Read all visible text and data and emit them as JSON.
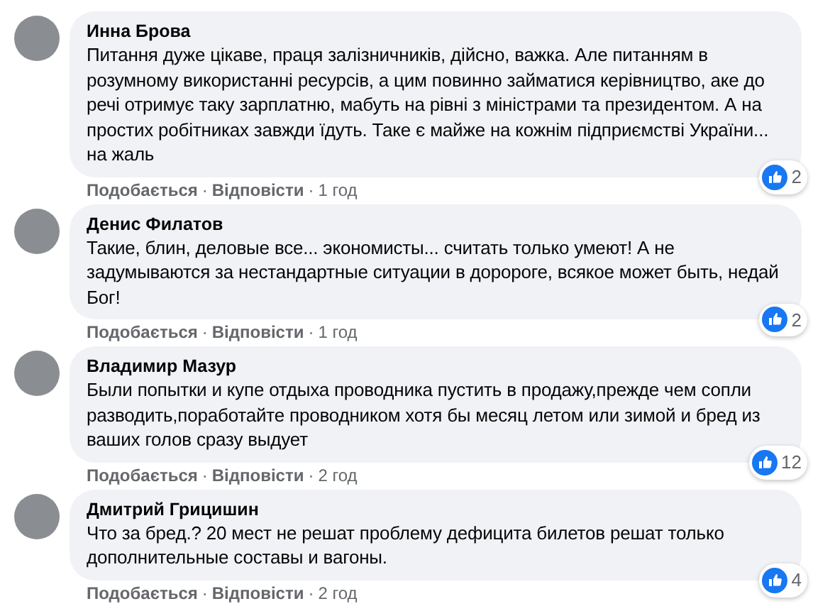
{
  "comments": [
    {
      "author": "Инна Брова",
      "text": "Питання дуже цікаве, праця залізничників, дійсно, важка. Але питанням в розумному використанні ресурсів, а цим повинно займатися керівництво, аке до речі отримує таку зарплатню, мабуть на рівні з міністрами та президентом. А на простих робітниках завжди їдуть. Таке є майже на кожнім підприємстві України... на жаль",
      "reactions": "2",
      "like": "Подобається",
      "separator_1": "·",
      "reply": "Відповісти",
      "separator_2": "·",
      "time": "1 год"
    },
    {
      "author": "Денис Филатов",
      "text": "Такие, блин, деловые все... экономисты... считать только умеют! А не задумываются за нестандартные ситуации в доророге, всякое может быть, недай Бог!",
      "reactions": "2",
      "like": "Подобається",
      "separator_1": "·",
      "reply": "Відповісти",
      "separator_2": "·",
      "time": "1 год"
    },
    {
      "author": "Владимир Мазур",
      "text": "Были попытки и купе отдыха проводника пустить в продажу,прежде чем сопли разводить,поработайте проводником хотя бы месяц летом или зимой и бред из ваших голов сразу выдует",
      "reactions": "12",
      "like": "Подобається",
      "separator_1": "·",
      "reply": "Відповісти",
      "separator_2": "·",
      "time": "2 год"
    },
    {
      "author": "Дмитрий Грицишин",
      "text": "Что за бред.? 20 мест не решат проблему дефицита билетов решат только дополнительные составы и вагоны.",
      "reactions": "4",
      "like": "Подобається",
      "separator_1": "·",
      "reply": "Відповісти",
      "separator_2": "·",
      "time": "2 год"
    }
  ]
}
